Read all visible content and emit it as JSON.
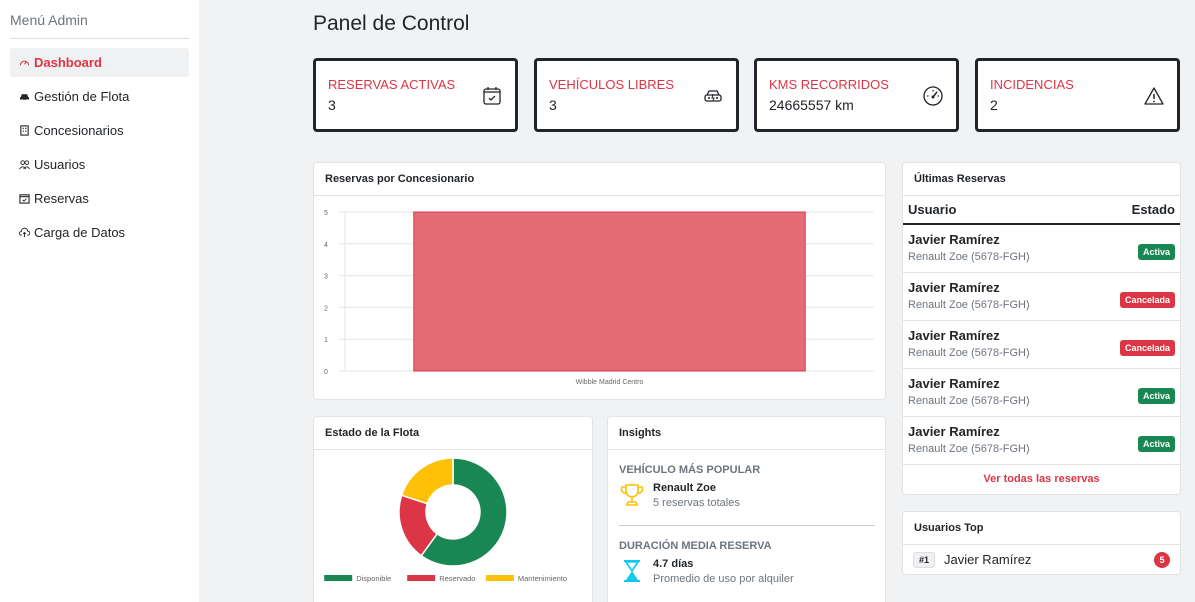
{
  "sidebar": {
    "title": "Menú Admin",
    "items": [
      {
        "label": "Dashboard",
        "active": true
      },
      {
        "label": "Gestión de Flota",
        "active": false
      },
      {
        "label": "Concesionarios",
        "active": false
      },
      {
        "label": "Usuarios",
        "active": false
      },
      {
        "label": "Reservas",
        "active": false
      },
      {
        "label": "Carga de Datos",
        "active": false
      }
    ]
  },
  "page_title": "Panel de Control",
  "stats": [
    {
      "label": "RESERVAS ACTIVAS",
      "value": "3",
      "icon": "calendar-check-icon"
    },
    {
      "label": "VEHÍCULOS LIBRES",
      "value": "3",
      "icon": "car-icon"
    },
    {
      "label": "KMS RECORRIDOS",
      "value": "24665557 km",
      "icon": "speedometer-icon"
    },
    {
      "label": "INCIDENCIAS",
      "value": "2",
      "icon": "warning-icon"
    }
  ],
  "bar_card": {
    "title": "Reservas por Concesionario"
  },
  "fleet_card": {
    "title": "Estado de la Flota"
  },
  "insights": {
    "title": "Insights",
    "popular_heading": "VEHÍCULO MÁS POPULAR",
    "popular_name": "Renault Zoe",
    "popular_detail": "5 reservas totales",
    "duration_heading": "DURACIÓN MEDIA RESERVA",
    "duration_value": "4.7 días",
    "duration_detail": "Promedio de uso por alquiler"
  },
  "reservations": {
    "title": "Últimas Reservas",
    "col_user": "Usuario",
    "col_status": "Estado",
    "rows": [
      {
        "user": "Javier Ramírez",
        "car": "Renault Zoe (5678-FGH)",
        "status": "Activa"
      },
      {
        "user": "Javier Ramírez",
        "car": "Renault Zoe (5678-FGH)",
        "status": "Cancelada"
      },
      {
        "user": "Javier Ramírez",
        "car": "Renault Zoe (5678-FGH)",
        "status": "Cancelada"
      },
      {
        "user": "Javier Ramírez",
        "car": "Renault Zoe (5678-FGH)",
        "status": "Activa"
      },
      {
        "user": "Javier Ramírez",
        "car": "Renault Zoe (5678-FGH)",
        "status": "Activa"
      }
    ],
    "view_all": "Ver todas las reservas"
  },
  "top_users": {
    "title": "Usuarios Top",
    "rows": [
      {
        "rank": "#1",
        "name": "Javier Ramírez",
        "count": "5"
      }
    ]
  },
  "colors": {
    "accent": "#dc3545",
    "success": "#198754",
    "warning": "#ffc107",
    "bar": "#e46c77"
  },
  "chart_data": [
    {
      "type": "bar",
      "title": "Reservas por Concesionario",
      "categories": [
        "Wibble Madrid Centro"
      ],
      "values": [
        5
      ],
      "ylim": [
        0,
        5
      ],
      "yticks": [
        "0",
        "1",
        "2",
        "3",
        "4",
        "5"
      ],
      "grid": true
    },
    {
      "type": "pie",
      "title": "Estado de la Flota",
      "labels": [
        "Disponible",
        "Reservado",
        "Mantenimiento"
      ],
      "values": [
        3,
        1,
        1
      ],
      "colors": [
        "#198754",
        "#dc3545",
        "#ffc107"
      ],
      "legend": "bottom"
    }
  ]
}
